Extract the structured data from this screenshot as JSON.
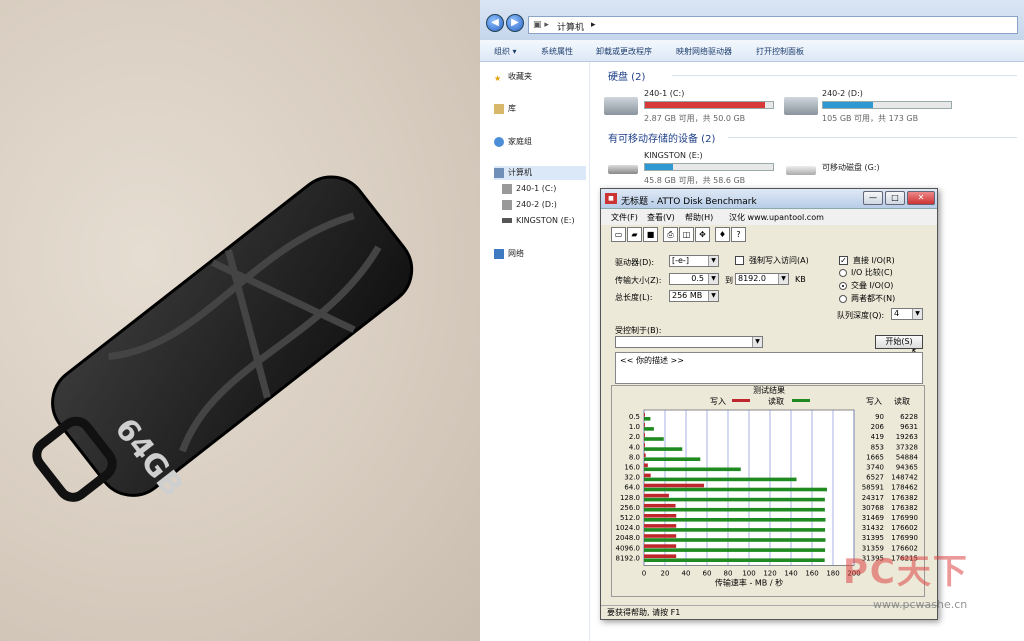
{
  "photo": {
    "capacity_label": "64GB"
  },
  "explorer": {
    "breadcrumb": [
      "计算机"
    ],
    "toolbar": [
      "组织 ▾",
      "系统属性",
      "卸载或更改程序",
      "映射网络驱动器",
      "打开控制面板"
    ],
    "nav": {
      "favorites": "收藏夹",
      "library": "库",
      "homegroup": "家庭组",
      "computer": "计算机",
      "drives": [
        "240-1 (C:)",
        "240-2 (D:)",
        "KINGSTON (E:)"
      ],
      "network": "网络"
    },
    "hard_disks": {
      "heading": "硬盘 (2)",
      "items": [
        {
          "name": "240-1 (C:)",
          "info": "2.87 GB 可用，共 50.0 GB",
          "used_fraction": 0.94,
          "color": "#d83a3a"
        },
        {
          "name": "240-2 (D:)",
          "info": "105 GB 可用，共 173 GB",
          "used_fraction": 0.39,
          "color": "#2f97d1"
        }
      ]
    },
    "removable": {
      "heading": "有可移动存储的设备 (2)",
      "items": [
        {
          "name": "KINGSTON (E:)",
          "info": "45.8 GB 可用，共 58.6 GB",
          "used_fraction": 0.22,
          "color": "#2f97d1"
        },
        {
          "name": "可移动磁盘 (G:)"
        }
      ]
    }
  },
  "atto": {
    "title": "无标题 - ATTO Disk Benchmark",
    "menu": [
      "文件(F)",
      "查看(V)",
      "帮助(H)",
      "汉化 www.upantool.com"
    ],
    "drive_label": "驱动器(D):",
    "drive_value": "[-e-]",
    "force_write_label": "强制写入访问(A)",
    "direct_io_label": "直接 I/O(R)",
    "transfer_label": "传输大小(Z):",
    "transfer_from": "0.5",
    "to_label": "到",
    "transfer_to": "8192.0",
    "kb_label": "KB",
    "length_label": "总长度(L):",
    "length_value": "256 MB",
    "io_compare_label": "I/O 比较(C)",
    "overlap_label": "交叠 I/O(O)",
    "neither_label": "两者都不(N)",
    "queue_label": "队列深度(Q):",
    "queue_value": "4",
    "control_label": "受控制于(B):",
    "start_button": "开始(S)",
    "description": "<< 你的描述 >>",
    "results_title": "测试结果",
    "write_legend": "写入",
    "read_legend": "读取",
    "col_write": "写入",
    "col_read": "读取",
    "xlabel": "传输速率 - MB / 秒",
    "status": "要获得帮助, 请按 F1",
    "colors": {
      "write": "#c0272d",
      "read": "#1f8a1f"
    }
  },
  "chart_data": {
    "type": "bar",
    "title": "测试结果",
    "xlabel": "传输速率 - MB / 秒",
    "xlim": [
      0,
      200
    ],
    "x_ticks": [
      0,
      20,
      40,
      60,
      80,
      100,
      120,
      140,
      160,
      180,
      200
    ],
    "categories": [
      "0.5",
      "1.0",
      "2.0",
      "4.0",
      "8.0",
      "16.0",
      "32.0",
      "64.0",
      "128.0",
      "256.0",
      "512.0",
      "1024.0",
      "2048.0",
      "4096.0",
      "8192.0"
    ],
    "series": [
      {
        "name": "写入",
        "values": [
          90,
          206,
          419,
          853,
          1665,
          3740,
          6527,
          58591,
          24317,
          30768,
          31469,
          31432,
          31395,
          31359,
          31395
        ]
      },
      {
        "name": "读取",
        "values": [
          6228,
          9631,
          19263,
          37328,
          54884,
          94365,
          148742,
          178462,
          176382,
          176382,
          176990,
          176602,
          176990,
          176602,
          176215
        ]
      }
    ],
    "units_note": "KB/s"
  },
  "watermark": {
    "text": "PC天下",
    "url": "www.pcwashe.cn"
  }
}
